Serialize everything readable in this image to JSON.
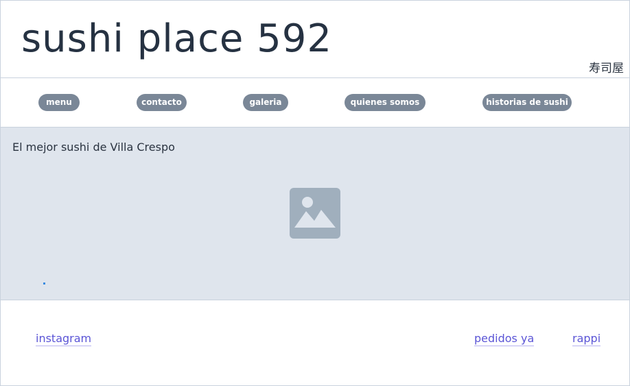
{
  "header": {
    "title": "sushi place 592",
    "kanji": "寿司屋"
  },
  "nav": {
    "items": [
      {
        "label": "menu"
      },
      {
        "label": "contacto"
      },
      {
        "label": "galeria"
      },
      {
        "label": "quienes somos"
      },
      {
        "label": "historias de sushi"
      }
    ]
  },
  "main": {
    "tagline": "El mejor sushi de Villa Crespo",
    "image_icon": "image-icon"
  },
  "footer": {
    "links": [
      {
        "label": "instagram"
      },
      {
        "label": "pedidos ya"
      },
      {
        "label": "rappi"
      }
    ]
  },
  "colors": {
    "nav_button_bg": "#7a8797",
    "main_bg": "#dfe5ed",
    "link": "#5b55d6",
    "border": "#c9d2dd"
  }
}
